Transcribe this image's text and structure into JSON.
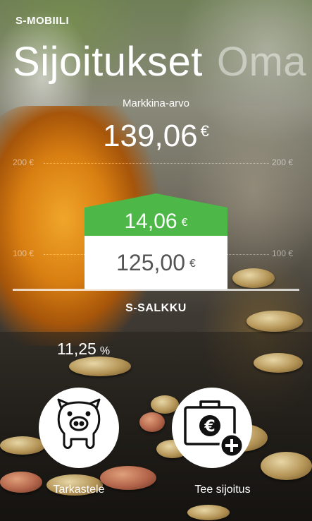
{
  "app": {
    "name": "S-MOBIILI"
  },
  "pivot": {
    "active": "Sijoitukset",
    "next": "Oma"
  },
  "market": {
    "label": "Markkina-arvo",
    "value": "139,06",
    "currency": "€"
  },
  "grid": {
    "upper": {
      "label": "200 €"
    },
    "lower": {
      "label": "100 €"
    }
  },
  "bar": {
    "gain": {
      "value": "14,06",
      "currency": "€",
      "color": "#4db848"
    },
    "invested": {
      "value": "125,00",
      "currency": "€",
      "color": "#ffffff"
    }
  },
  "portfolio": {
    "name": "S-SALKKU",
    "return_value": "11,25",
    "return_unit": "%"
  },
  "actions": [
    {
      "label": "Tarkastele",
      "icon": "piggy-bank-icon"
    },
    {
      "label": "Tee sijoitus",
      "icon": "euro-briefcase-add-icon"
    }
  ]
}
